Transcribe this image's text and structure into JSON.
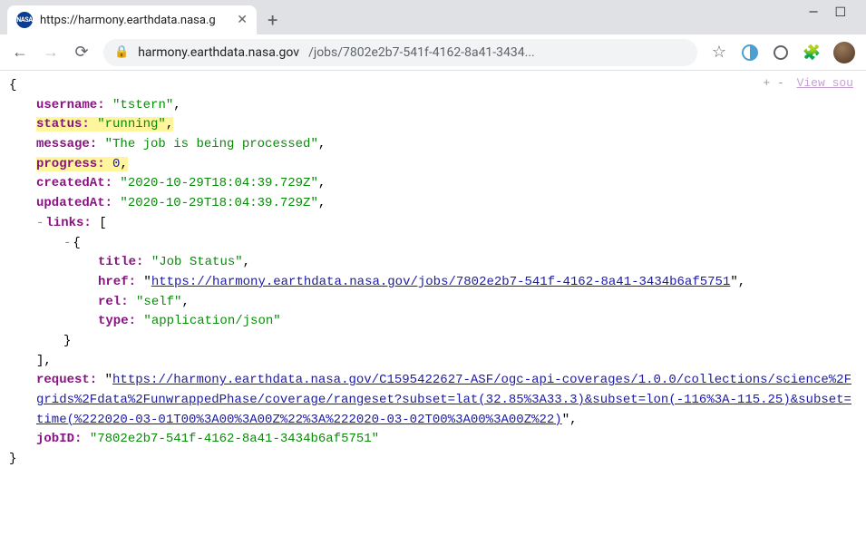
{
  "window": {
    "minimize": "—",
    "maximize": "☐"
  },
  "tab": {
    "title": "https://harmony.earthdata.nasa.g",
    "close": "✕",
    "newTab": "+"
  },
  "toolbar": {
    "back": "←",
    "forward": "→",
    "reload": "⟳",
    "lock": "🔒",
    "urlHost": "harmony.earthdata.nasa.gov",
    "urlPath": "/jobs/7802e2b7-541f-4162-8a41-3434...",
    "star": "☆",
    "puzzle": "🧩"
  },
  "actions": {
    "plus": "+",
    "minus": "-",
    "viewSource": "View sou"
  },
  "json": {
    "username_k": "username:",
    "username_v": "\"tstern\"",
    "status_k": "status:",
    "status_v": "\"running\"",
    "message_k": "message:",
    "message_v": "\"The job is being processed\"",
    "progress_k": "progress:",
    "progress_v": "0",
    "createdAt_k": "createdAt:",
    "createdAt_v": "\"2020-10-29T18:04:39.729Z\"",
    "updatedAt_k": "updatedAt:",
    "updatedAt_v": "\"2020-10-29T18:04:39.729Z\"",
    "links_k": "links:",
    "link0": {
      "title_k": "title:",
      "title_v": "\"Job Status\"",
      "href_k": "href:",
      "href_v": "https://harmony.earthdata.nasa.gov/jobs/7802e2b7-541f-4162-8a41-3434b6af5751",
      "rel_k": "rel:",
      "rel_v": "\"self\"",
      "type_k": "type:",
      "type_v": "\"application/json\""
    },
    "request_k": "request:",
    "request_v": "https://harmony.earthdata.nasa.gov/C1595422627-ASF/ogc-api-coverages/1.0.0/collections/science%2Fgrids%2Fdata%2FunwrappedPhase/coverage/rangeset?subset=lat(32.85%3A33.3)&subset=lon(-116%3A-115.25)&subset=time(%222020-03-01T00%3A00%3A00Z%22%3A%222020-03-02T00%3A00%3A00Z%22)",
    "jobID_k": "jobID:",
    "jobID_v": "\"7802e2b7-541f-4162-8a41-3434b6af5751\""
  }
}
